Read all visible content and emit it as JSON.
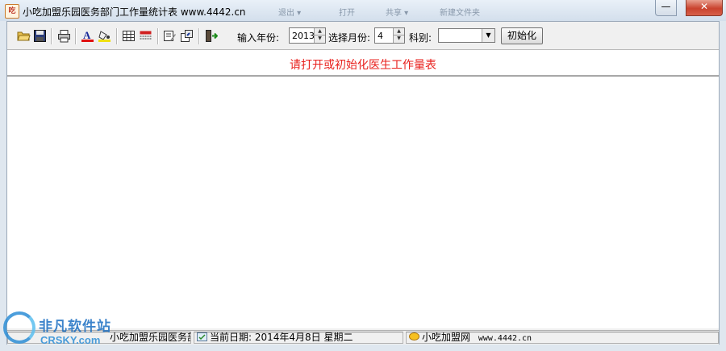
{
  "window": {
    "title": "小吃加盟乐园医务部门工作量统计表  www.4442.cn",
    "app_icon_text": "吃",
    "ghost_text": [
      "退出 ▾",
      "打开",
      "共享 ▾",
      "新建文件夹"
    ]
  },
  "toolbar": {
    "icons": [
      "open-folder-icon",
      "save-icon",
      "print-icon",
      "font-color-icon",
      "fill-color-icon",
      "table-icon",
      "grid-icon",
      "edit-icon",
      "export-icon",
      "exit-icon"
    ],
    "year_label": "输入年份:",
    "year_value": "2013",
    "month_label": "选择月份:",
    "month_value": "4",
    "dept_label": "科别:",
    "dept_value": "",
    "init_button": "初始化"
  },
  "message": "请打开或初始化医生工作量表",
  "statusbar": {
    "panel1": "小吃加盟乐园医务部门工作量统计表",
    "panel2": "当前日期: 2014年4月8日  星期二",
    "panel3_site": "小吃加盟网",
    "panel3_url": "www.4442.cn"
  },
  "watermark": {
    "line1": "非凡软件站",
    "line2": "CRSKY.com"
  },
  "colors": {
    "message": "#e8201c",
    "close_button": "#c9432e",
    "watermark": "#2d8ed6"
  }
}
